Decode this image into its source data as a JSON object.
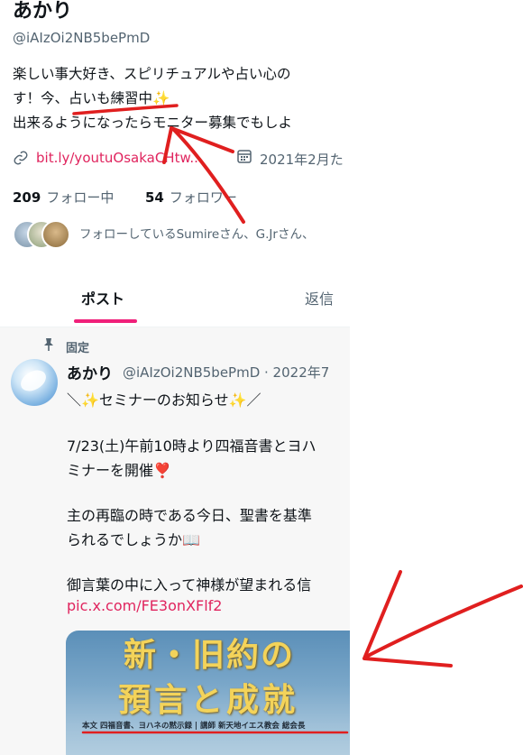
{
  "profile": {
    "name": "あかり",
    "handle": "@iAIzOi2NB5bePmD",
    "bio_line1": "楽しい事大好き、スピリチュアルや占い心の",
    "bio_line2_pre": "す！今、",
    "bio_line2_highlight": "占いも練習中✨",
    "bio_line3": "出来るようになったらモニター募集でもしよ",
    "link": "bit.ly/youtuOsakaCHtw...",
    "joined": "2021年2月た",
    "following_count": "209",
    "following_label": "フォロー中",
    "followers_count": "54",
    "followers_label": "フォロワー",
    "followed_by": "フォローしているSumireさん、G.Jrさん、"
  },
  "tabs": {
    "post": "ポスト",
    "replies": "返信"
  },
  "pinned_post": {
    "pinned_label": "固定",
    "author": "あかり",
    "handle_date": "@iAIzOi2NB5bePmD · 2022年7",
    "lines": [
      "＼✨セミナーのお知らせ✨／",
      "7/23(土)午前10時より四福音書とヨハ",
      "ミナーを開催❣️",
      "主の再臨の時である今日、聖書を基準",
      "られるでしょうか📖",
      "御言葉の中に入って神様が望まれる信"
    ],
    "link": "pic.x.com/FE3onXFlf2",
    "media_title1": "新・旧約の",
    "media_title2": "預言と成就",
    "media_caption": "本文 四福音書、ヨハネの黙示録 | 講師 新天地イエス教会 総会長"
  },
  "colors": {
    "accent": "#f0207a",
    "link": "#e0245e",
    "annotation": "#e01f1f"
  }
}
